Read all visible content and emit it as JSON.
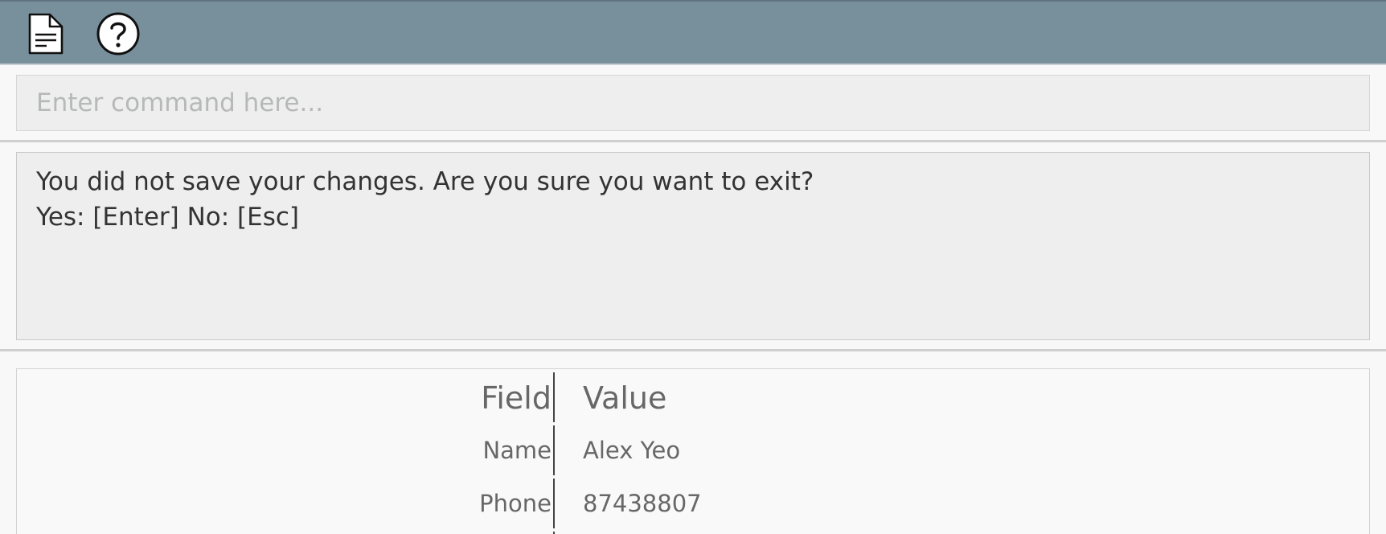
{
  "toolbar": {
    "icons": [
      "file-document-icon",
      "help-question-icon"
    ]
  },
  "command": {
    "placeholder": "Enter command here...",
    "value": ""
  },
  "result": {
    "line1": "You did not save your changes. Are you sure you want to exit?",
    "line2": "Yes: [Enter] No: [Esc]"
  },
  "details": {
    "header": {
      "field": "Field",
      "value": "Value"
    },
    "rows": [
      {
        "field": "Name",
        "value": "Alex Yeo"
      },
      {
        "field": "Phone",
        "value": "87438807"
      }
    ]
  },
  "colors": {
    "toolbar": "#78909c",
    "panel": "#edeeed",
    "text": "#333333",
    "muted_text": "#676767"
  }
}
